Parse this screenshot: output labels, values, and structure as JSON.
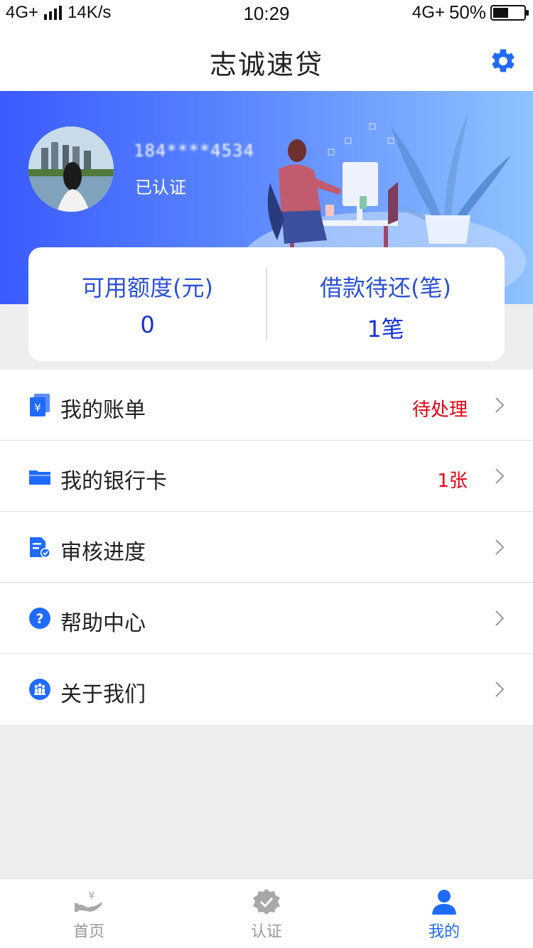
{
  "status_bar": {
    "network": "4G+",
    "speed": "14K/s",
    "time": "10:29",
    "network_right": "4G+",
    "battery": "50%",
    "battery_level": 0.5
  },
  "header": {
    "title": "志诚速贷",
    "settings_icon": "gear-icon"
  },
  "profile": {
    "phone": "184****4534",
    "status": "已认证",
    "avatar_icon": "avatar-photo"
  },
  "stats": {
    "left": {
      "label": "可用额度(元)",
      "value": "0"
    },
    "right": {
      "label": "借款待还(笔)",
      "value": "1笔"
    }
  },
  "menu": [
    {
      "icon": "bill-icon",
      "label": "我的账单",
      "value": "待处理"
    },
    {
      "icon": "bank-card-icon",
      "label": "我的银行卡",
      "value": "1张"
    },
    {
      "icon": "review-progress-icon",
      "label": "审核进度",
      "value": ""
    },
    {
      "icon": "help-icon",
      "label": "帮助中心",
      "value": ""
    },
    {
      "icon": "about-icon",
      "label": "关于我们",
      "value": ""
    }
  ],
  "tabs": [
    {
      "icon": "loan-hand-icon",
      "label": "首页",
      "active": false
    },
    {
      "icon": "verified-badge-icon",
      "label": "认证",
      "active": false
    },
    {
      "icon": "user-icon",
      "label": "我的",
      "active": true
    }
  ],
  "colors": {
    "accent": "#1f6bff",
    "alert": "#e60012",
    "banner_start": "#3a5bff",
    "banner_end": "#8fc3ff"
  }
}
